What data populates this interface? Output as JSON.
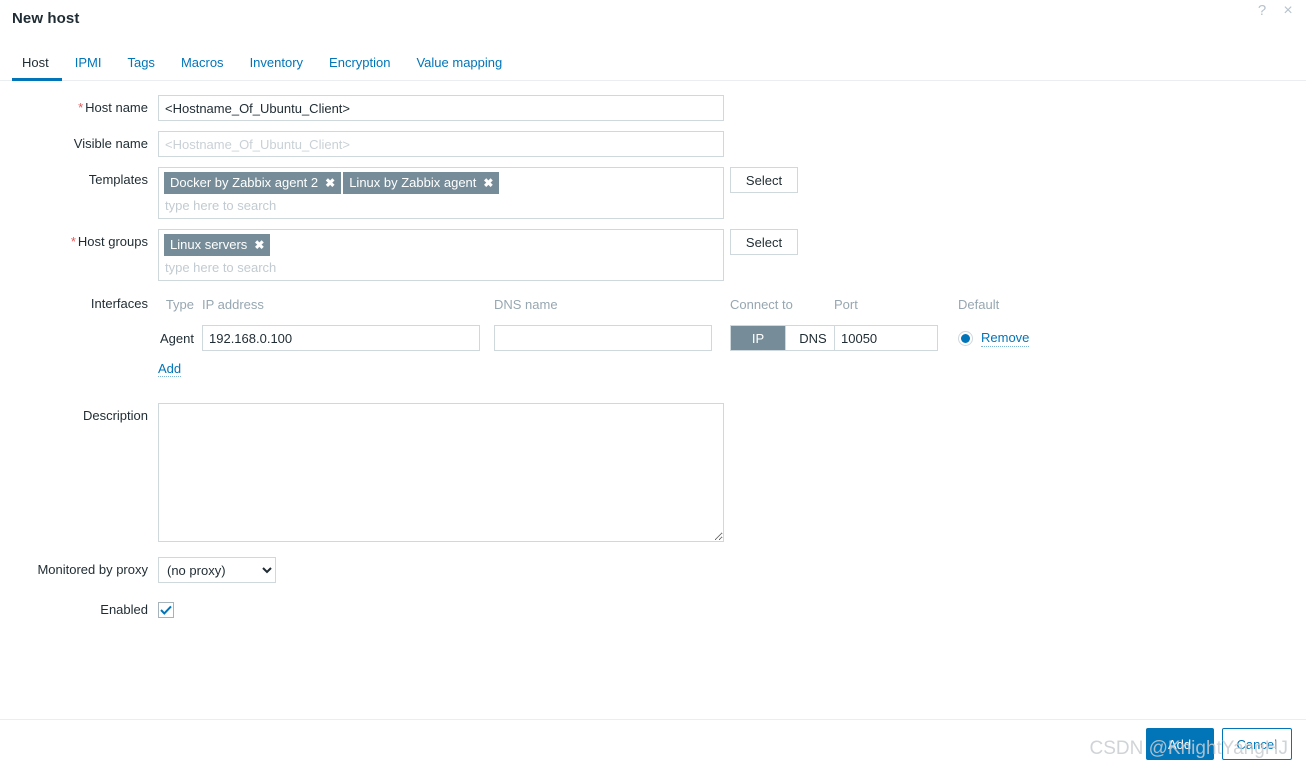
{
  "dialog": {
    "title": "New host",
    "help_icon": "question-mark-icon",
    "help_label": "?",
    "close_label": "×"
  },
  "tabs": [
    {
      "label": "Host",
      "active": true
    },
    {
      "label": "IPMI",
      "active": false
    },
    {
      "label": "Tags",
      "active": false
    },
    {
      "label": "Macros",
      "active": false
    },
    {
      "label": "Inventory",
      "active": false
    },
    {
      "label": "Encryption",
      "active": false
    },
    {
      "label": "Value mapping",
      "active": false
    }
  ],
  "form": {
    "host_name": {
      "label": "Host name",
      "required_marker": "*",
      "value": "<Hostname_Of_Ubuntu_Client>"
    },
    "visible_name": {
      "label": "Visible name",
      "value": "",
      "placeholder": "<Hostname_Of_Ubuntu_Client>"
    },
    "templates": {
      "label": "Templates",
      "chips": [
        {
          "text": "Docker by Zabbix agent 2",
          "remove": "✖"
        },
        {
          "text": "Linux by Zabbix agent",
          "remove": "✖"
        }
      ],
      "placeholder": "type here to search",
      "select_label": "Select"
    },
    "host_groups": {
      "label": "Host groups",
      "required_marker": "*",
      "chips": [
        {
          "text": "Linux servers",
          "remove": "✖"
        }
      ],
      "placeholder": "type here to search",
      "select_label": "Select"
    },
    "interfaces": {
      "label": "Interfaces",
      "headers": {
        "type": "Type",
        "ip": "IP address",
        "dns": "DNS name",
        "connect_to": "Connect to",
        "port": "Port",
        "default": "Default"
      },
      "rows": [
        {
          "type": "Agent",
          "ip": "192.168.0.100",
          "dns": "",
          "connect_ip": "IP",
          "connect_dns": "DNS",
          "connect_selected": "IP",
          "port": "10050",
          "default_selected": true,
          "remove_label": "Remove"
        }
      ],
      "add_label": "Add"
    },
    "description": {
      "label": "Description",
      "value": ""
    },
    "proxy": {
      "label": "Monitored by proxy",
      "value": "(no proxy)",
      "options": [
        "(no proxy)"
      ]
    },
    "enabled": {
      "label": "Enabled",
      "checked": true
    }
  },
  "footer": {
    "add_label": "Add",
    "cancel_label": "Cancel"
  },
  "watermark": {
    "text": "CSDN @KnightYangHJ"
  },
  "colors": {
    "accent": "#0275b8",
    "chip": "#768d99",
    "required": "#e45959",
    "muted": "#97a7b1"
  }
}
